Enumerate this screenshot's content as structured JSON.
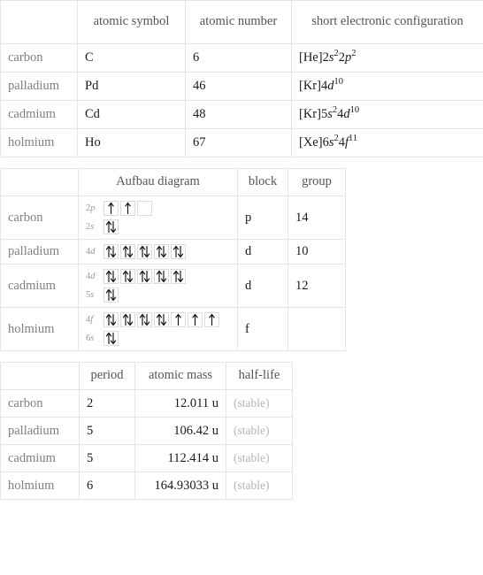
{
  "tables": {
    "atomic_identity": {
      "columns": [
        "",
        "atomic symbol",
        "atomic number",
        "short electronic configuration"
      ],
      "rows": [
        {
          "name": "carbon",
          "symbol": "C",
          "atomic_number": "6",
          "short_electronic_configuration": "[He]2<i>s</i><sup>2</sup>2<i>p</i><sup>2</sup>"
        },
        {
          "name": "palladium",
          "symbol": "Pd",
          "atomic_number": "46",
          "short_electronic_configuration": "[Kr]4<i>d</i><sup>10</sup>"
        },
        {
          "name": "cadmium",
          "symbol": "Cd",
          "atomic_number": "48",
          "short_electronic_configuration": "[Kr]5<i>s</i><sup>2</sup>4<i>d</i><sup>10</sup>"
        },
        {
          "name": "holmium",
          "symbol": "Ho",
          "atomic_number": "67",
          "short_electronic_configuration": "[Xe]6<i>s</i><sup>2</sup>4<i>f</i><sup>11</sup>"
        }
      ]
    },
    "aufbau": {
      "columns": [
        "",
        "Aufbau diagram",
        "block",
        "group"
      ],
      "rows": [
        {
          "name": "carbon",
          "block": "p",
          "group": "14",
          "shells": [
            {
              "label": "2s",
              "label_n": "2",
              "label_orbital": "s",
              "boxes": [
                "pair"
              ]
            },
            {
              "label": "2p",
              "label_n": "2",
              "label_orbital": "p",
              "boxes": [
                "up",
                "up",
                "empty"
              ]
            }
          ]
        },
        {
          "name": "palladium",
          "block": "d",
          "group": "10",
          "shells": [
            {
              "label": "4d",
              "label_n": "4",
              "label_orbital": "d",
              "boxes": [
                "pair",
                "pair",
                "pair",
                "pair",
                "pair"
              ]
            }
          ]
        },
        {
          "name": "cadmium",
          "block": "d",
          "group": "12",
          "shells": [
            {
              "label": "5s",
              "label_n": "5",
              "label_orbital": "s",
              "boxes": [
                "pair"
              ]
            },
            {
              "label": "4d",
              "label_n": "4",
              "label_orbital": "d",
              "boxes": [
                "pair",
                "pair",
                "pair",
                "pair",
                "pair"
              ]
            }
          ]
        },
        {
          "name": "holmium",
          "block": "f",
          "group": "",
          "shells": [
            {
              "label": "6s",
              "label_n": "6",
              "label_orbital": "s",
              "boxes": [
                "pair"
              ]
            },
            {
              "label": "4f",
              "label_n": "4",
              "label_orbital": "f",
              "boxes": [
                "pair",
                "pair",
                "pair",
                "pair",
                "up",
                "up",
                "up"
              ]
            }
          ]
        }
      ]
    },
    "properties": {
      "columns": [
        "",
        "period",
        "atomic mass",
        "half-life"
      ],
      "rows": [
        {
          "name": "carbon",
          "period": "2",
          "atomic_mass": "12.011 u",
          "half_life": "(stable)"
        },
        {
          "name": "palladium",
          "period": "5",
          "atomic_mass": "106.42 u",
          "half_life": "(stable)"
        },
        {
          "name": "cadmium",
          "period": "5",
          "atomic_mass": "112.414 u",
          "half_life": "(stable)"
        },
        {
          "name": "holmium",
          "period": "6",
          "atomic_mass": "164.93033 u",
          "half_life": "(stable)"
        }
      ]
    }
  },
  "colors": {
    "border": "#e6e6e6",
    "row_header_text": "#808080",
    "value_text": "#1a1a1a",
    "muted_text": "#b5b5b5",
    "orbital_box_border": "#dcdcdc",
    "arrow": "#111111"
  }
}
